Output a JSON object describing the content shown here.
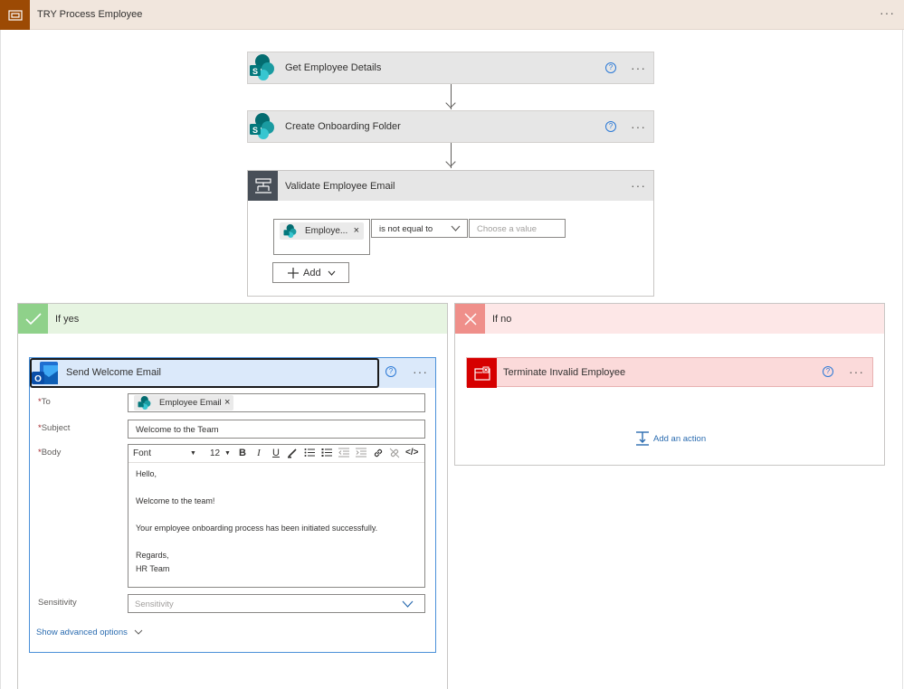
{
  "scope": {
    "title": "TRY Process Employee",
    "icon": "scope-icon",
    "color": "#9c4a04"
  },
  "actions": {
    "get_employee": {
      "title": "Get Employee Details",
      "icon": "sharepoint-icon"
    },
    "create_folder": {
      "title": "Create Onboarding Folder",
      "icon": "sharepoint-icon"
    }
  },
  "condition": {
    "title": "Validate Employee Email",
    "icon": "condition-icon",
    "token_label": "Employe...",
    "operator": "is not equal to",
    "value_placeholder": "Choose a value",
    "add_label": "Add"
  },
  "yes_branch": {
    "title": "If yes",
    "color": "#8fd18a",
    "email": {
      "title": "Send Welcome Email",
      "icon": "outlook-icon",
      "to_label": "To",
      "to_token": "Employee Email",
      "subject_label": "Subject",
      "subject_value": "Welcome to the Team",
      "body_label": "Body",
      "font_value": "Font",
      "size_value": "12",
      "body_lines": [
        "Hello,",
        "Welcome to the team!",
        "Your employee onboarding process has been initiated successfully.",
        "Regards,",
        "HR Team"
      ],
      "sensitivity_label": "Sensitivity",
      "sensitivity_placeholder": "Sensitivity",
      "advanced_label": "Show advanced options"
    }
  },
  "no_branch": {
    "title": "If no",
    "color": "#ef8f8a",
    "terminate": {
      "title": "Terminate Invalid Employee",
      "icon": "terminate-icon"
    },
    "add_action_label": "Add an action"
  },
  "help_symbol": "?",
  "more_symbol": "···",
  "required_marker": "*",
  "remove_symbol": "×"
}
